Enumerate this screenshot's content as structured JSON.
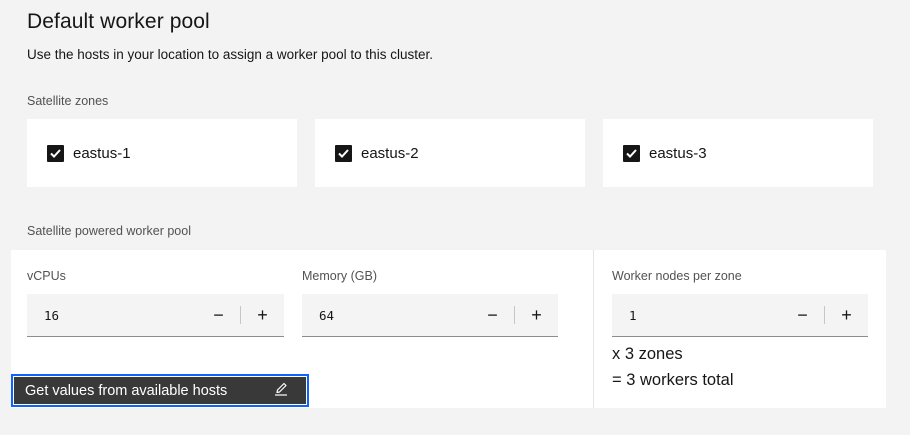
{
  "header": {
    "title": "Default worker pool",
    "description": "Use the hosts in your location to assign a worker pool to this cluster."
  },
  "zones": {
    "label": "Satellite zones",
    "items": [
      {
        "name": "eastus-1",
        "checked": true
      },
      {
        "name": "eastus-2",
        "checked": true
      },
      {
        "name": "eastus-3",
        "checked": true
      }
    ]
  },
  "pool": {
    "label": "Satellite powered worker pool",
    "vcpus": {
      "label": "vCPUs",
      "value": "16"
    },
    "memory": {
      "label": "Memory (GB)",
      "value": "64"
    },
    "workers": {
      "label": "Worker nodes per zone",
      "value": "1"
    },
    "zones_multiplier": "x 3 zones",
    "total": "= 3 workers total",
    "hosts_button": "Get values from available hosts",
    "decrement_symbol": "−",
    "increment_symbol": "+"
  },
  "icons": {
    "checkbox": "checkmark-icon",
    "edit": "pencil-icon"
  },
  "colors": {
    "accent": "#0f62fe",
    "button_bg": "#393939",
    "tile_bg": "#ffffff",
    "page_bg": "#f3f3f3"
  }
}
